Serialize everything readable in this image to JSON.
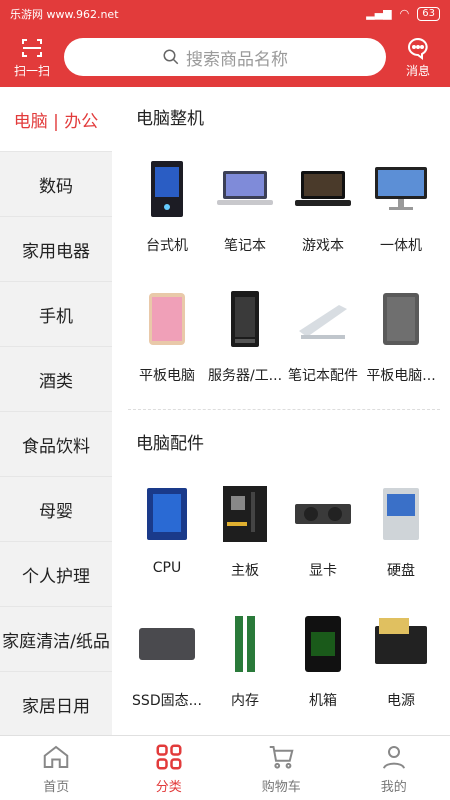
{
  "statusbar": {
    "site": "乐游网 www.962.net",
    "battery": "63"
  },
  "header": {
    "scan_label": "扫一扫",
    "search_placeholder": "搜索商品名称",
    "message_label": "消息"
  },
  "sidebar": {
    "items": [
      {
        "label": "电脑 | 办公"
      },
      {
        "label": "数码"
      },
      {
        "label": "家用电器"
      },
      {
        "label": "手机"
      },
      {
        "label": "酒类"
      },
      {
        "label": "食品饮料"
      },
      {
        "label": "母婴"
      },
      {
        "label": "个人护理"
      },
      {
        "label": "家庭清洁/纸品"
      },
      {
        "label": "家居日用"
      }
    ]
  },
  "sections": [
    {
      "title": "电脑整机",
      "items": [
        {
          "label": "台式机",
          "icon": "desktop-tower-icon"
        },
        {
          "label": "笔记本",
          "icon": "laptop-icon"
        },
        {
          "label": "游戏本",
          "icon": "gaming-laptop-icon"
        },
        {
          "label": "一体机",
          "icon": "all-in-one-icon"
        },
        {
          "label": "平板电脑",
          "icon": "tablet-icon"
        },
        {
          "label": "服务器/工...",
          "icon": "server-icon"
        },
        {
          "label": "笔记本配件",
          "icon": "laptop-stand-icon"
        },
        {
          "label": "平板电脑...",
          "icon": "tablet-case-icon"
        }
      ]
    },
    {
      "title": "电脑配件",
      "items": [
        {
          "label": "CPU",
          "icon": "cpu-icon"
        },
        {
          "label": "主板",
          "icon": "motherboard-icon"
        },
        {
          "label": "显卡",
          "icon": "graphics-card-icon"
        },
        {
          "label": "硬盘",
          "icon": "hard-drive-icon"
        },
        {
          "label": "SSD固态...",
          "icon": "ssd-icon"
        },
        {
          "label": "内存",
          "icon": "ram-icon"
        },
        {
          "label": "机箱",
          "icon": "pc-case-icon"
        },
        {
          "label": "电源",
          "icon": "power-supply-icon"
        }
      ]
    }
  ],
  "tabbar": {
    "items": [
      {
        "label": "首页"
      },
      {
        "label": "分类"
      },
      {
        "label": "购物车"
      },
      {
        "label": "我的"
      }
    ]
  },
  "colors": {
    "accent": "#e23b3b"
  }
}
